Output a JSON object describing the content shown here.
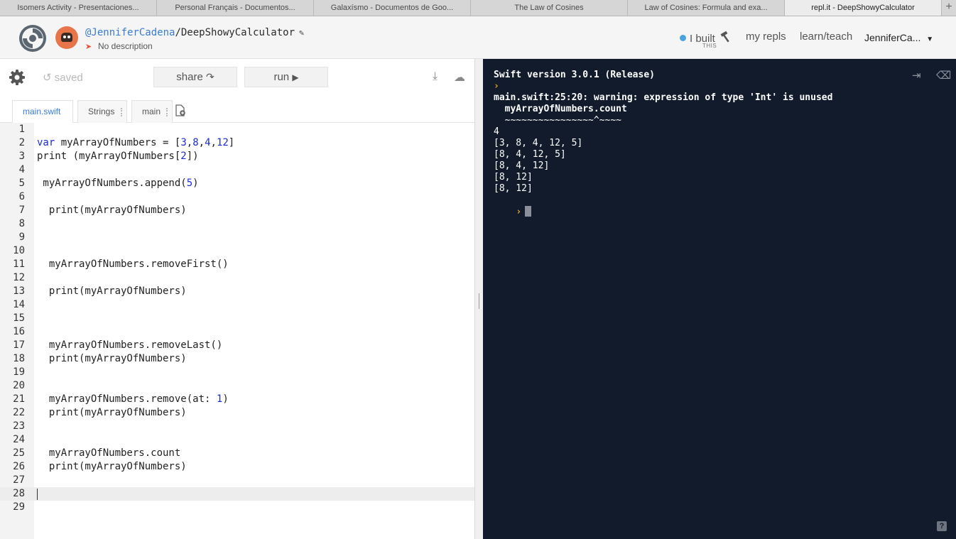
{
  "browser": {
    "tabs": [
      "Isomers Activity - Presentaciones...",
      "Personal Français - Documentos...",
      "Galaxísmo - Documentos de Goo...",
      "The Law of Cosines",
      "Law of Cosines: Formula and exa...",
      "repl.it - DeepShowyCalculator"
    ],
    "new_tab": "+"
  },
  "header": {
    "user": "@JenniferCadena",
    "separator": "/",
    "repl_name": "DeepShowyCalculator",
    "description": "No description",
    "nav": {
      "ibuilt": "I built",
      "ibuilt_sub": "THIS",
      "my_repls": "my repls",
      "learn_teach": "learn/teach",
      "username": "JenniferCa..."
    }
  },
  "toolbar": {
    "saved_label": "saved",
    "share_label": "share",
    "run_label": "run"
  },
  "file_tabs": [
    "main.swift",
    "Strings",
    "main"
  ],
  "editor": {
    "lines": [
      "",
      "var myArrayOfNumbers = [3,8,4,12]",
      "print (myArrayOfNumbers[2])",
      "",
      " myArrayOfNumbers.append(5)",
      "",
      "  print(myArrayOfNumbers)",
      "",
      "",
      "",
      "  myArrayOfNumbers.removeFirst()",
      "",
      "  print(myArrayOfNumbers)",
      "",
      "",
      "",
      "  myArrayOfNumbers.removeLast()",
      "  print(myArrayOfNumbers)",
      "",
      "",
      "  myArrayOfNumbers.remove(at: 1)",
      "  print(myArrayOfNumbers)",
      "",
      "",
      "  myArrayOfNumbers.count",
      "  print(myArrayOfNumbers)",
      "",
      "",
      ""
    ],
    "current_line": 28
  },
  "console": {
    "version": "Swift version 3.0.1 (Release)",
    "prompt": "›",
    "warning": "main.swift:25:20: warning: expression of type 'Int' is unused",
    "warning_code": "  myArrayOfNumbers.count",
    "warning_marker": "  ~~~~~~~~~~~~~~~~^~~~~",
    "output": [
      "4",
      "[3, 8, 4, 12, 5]",
      "[8, 4, 12, 5]",
      "[8, 4, 12]",
      "[8, 12]",
      "[8, 12]"
    ],
    "help": "?"
  },
  "colors": {
    "console_bg": "#111b2b",
    "prompt": "#f0a030",
    "link_blue": "#3a7bd5",
    "keyword_blue": "#1a2bd6"
  }
}
